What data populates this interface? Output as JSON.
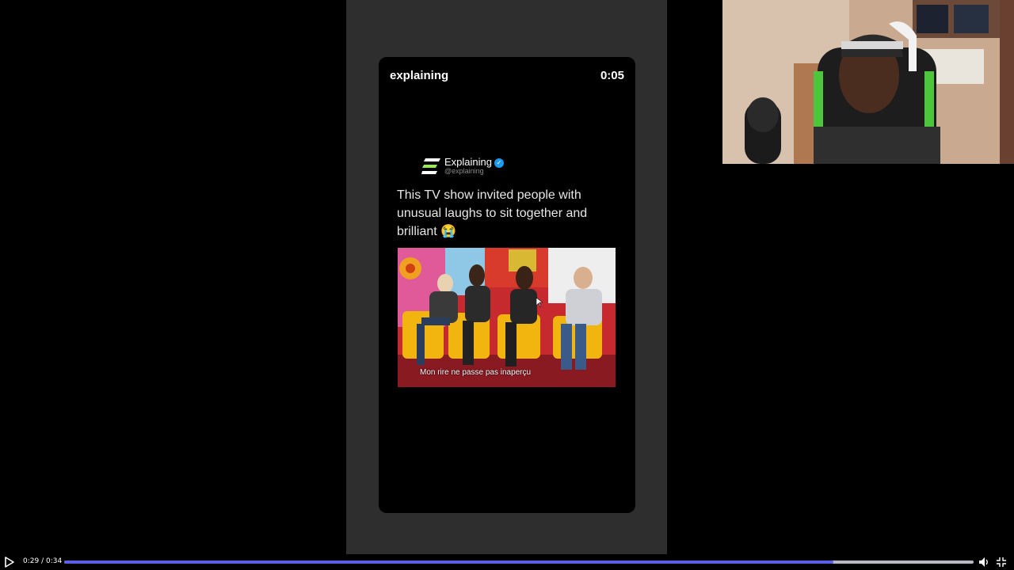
{
  "short": {
    "title": "explaining",
    "timestamp": "0:05"
  },
  "tweet": {
    "author": "Explaining",
    "handle": "@explaining",
    "text": "This TV show invited people with unusual laughs to sit together and brilliant 😭",
    "media_caption": "Mon rire ne passe pas inaperçu"
  },
  "player": {
    "time": "0:29 / 0:34",
    "progress": 0.846
  },
  "colors": {
    "progress_fill": "#5b5fe6",
    "progress_track": "#b9b9c5",
    "verified_badge": "#1d9bf0",
    "center_panel": "#2e2e2e"
  },
  "icons": [
    "play-icon",
    "volume-icon",
    "exit-fullscreen-icon",
    "verified-icon",
    "explaining-logo"
  ]
}
